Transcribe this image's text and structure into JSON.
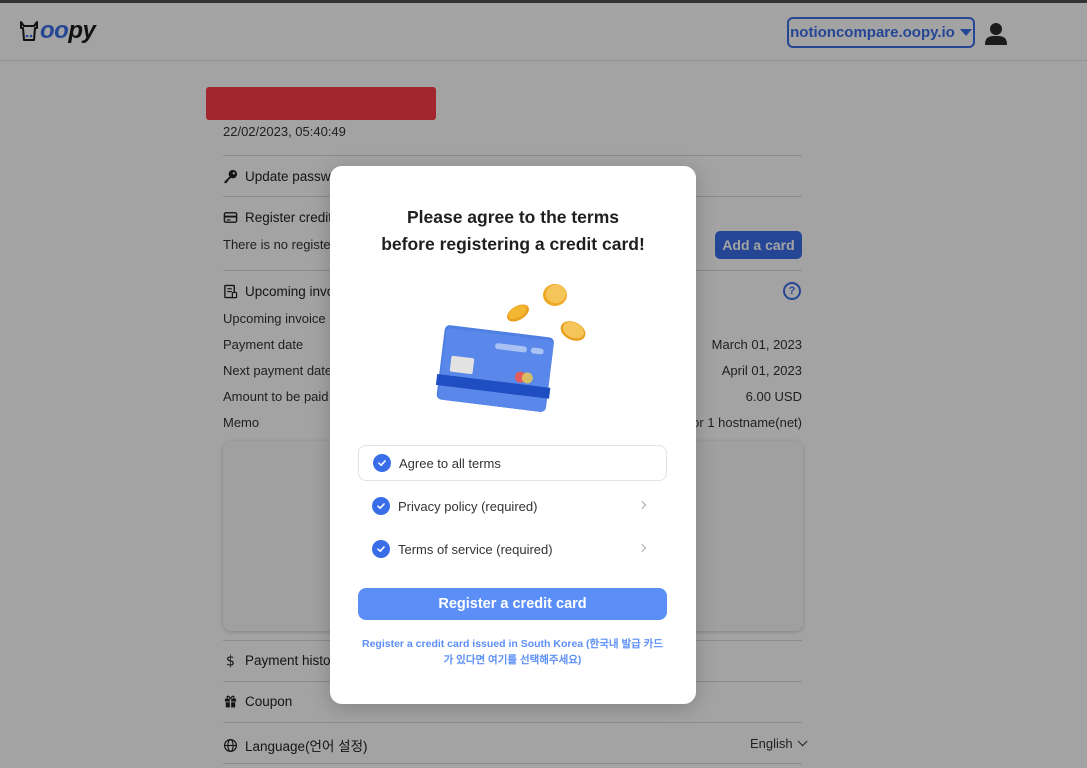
{
  "header": {
    "logo_oo": "oo",
    "logo_py": "py",
    "site_selector": "notioncompare.oopy.io"
  },
  "account": {
    "timestamp": "22/02/2023, 05:40:49"
  },
  "sections": {
    "update_password": "Update password",
    "register_credit_card": "Register credit card",
    "no_card_text": "There is no registered credit card",
    "add_card_button": "Add a card",
    "upcoming_invoice_title": "Upcoming invoice",
    "help_icon_glyph": "?",
    "invoice_rows": [
      {
        "label": "Upcoming invoice",
        "value": ""
      },
      {
        "label": "Payment date",
        "value": "March 01, 2023"
      },
      {
        "label": "Next payment date",
        "value": "April 01, 2023"
      },
      {
        "label": "Amount to be paid",
        "value": "6.00 USD"
      },
      {
        "label": "Memo",
        "value": "for 1 hostname(net)"
      }
    ],
    "payment_history": "Payment history",
    "coupon": "Coupon",
    "language": "Language(언어 설정)",
    "language_value": "English"
  },
  "modal": {
    "title_line1": "Please agree to the terms",
    "title_line2": "before registering a credit card!",
    "terms": [
      {
        "label": "Agree to all terms",
        "checked": true
      },
      {
        "label": "Privacy policy (required)",
        "checked": true
      },
      {
        "label": "Terms of service (required)",
        "checked": true
      }
    ],
    "register_button": "Register a credit card",
    "korea_link_line1": "Register a credit card issued in South Korea (한국내 발급 카드",
    "korea_link_line2": "가 있다면 여기를 선택해주세요)"
  },
  "colors": {
    "accent": "#3a6ee8",
    "button": "#5b8ff7",
    "redaction": "#ff3a47",
    "coin": "#f2b630"
  }
}
